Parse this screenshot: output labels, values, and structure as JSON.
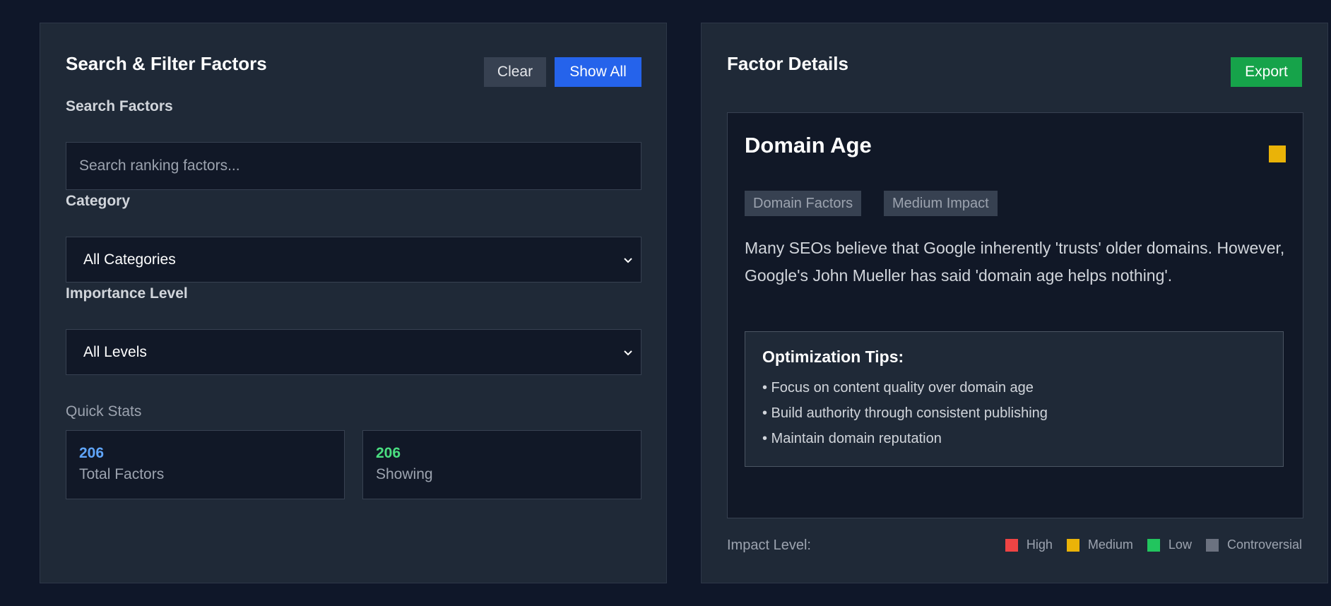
{
  "left_panel": {
    "title": "Search & Filter Factors",
    "clear_label": "Clear",
    "show_all_label": "Show All",
    "search_label": "Search Factors",
    "search_placeholder": "Search ranking factors...",
    "category_label": "Category",
    "category_value": "All Categories",
    "importance_label": "Importance Level",
    "importance_value": "All Levels",
    "quick_stats_label": "Quick Stats",
    "stats": {
      "total_value": "206",
      "total_label": "Total Factors",
      "showing_value": "206",
      "showing_label": "Showing"
    }
  },
  "right_panel": {
    "title": "Factor Details",
    "export_label": "Export",
    "factor": {
      "name": "Domain Age",
      "category_tag": "Domain Factors",
      "impact_tag": "Medium Impact",
      "impact_color": "#eab308",
      "description": "Many SEOs believe that Google inherently 'trusts' older domains. However, Google's John Mueller has said 'domain age helps nothing'.",
      "tips_title": "Optimization Tips:",
      "tips": [
        "• Focus on content quality over domain age",
        "• Build authority through consistent publishing",
        "• Maintain domain reputation"
      ]
    },
    "legend": {
      "label": "Impact Level:",
      "items": [
        {
          "label": "High",
          "color": "#ef4444"
        },
        {
          "label": "Medium",
          "color": "#eab308"
        },
        {
          "label": "Low",
          "color": "#22c55e"
        },
        {
          "label": "Controversial",
          "color": "#6b7280"
        }
      ]
    }
  },
  "icons": {
    "select_arrow": "chevron-down-icon"
  }
}
